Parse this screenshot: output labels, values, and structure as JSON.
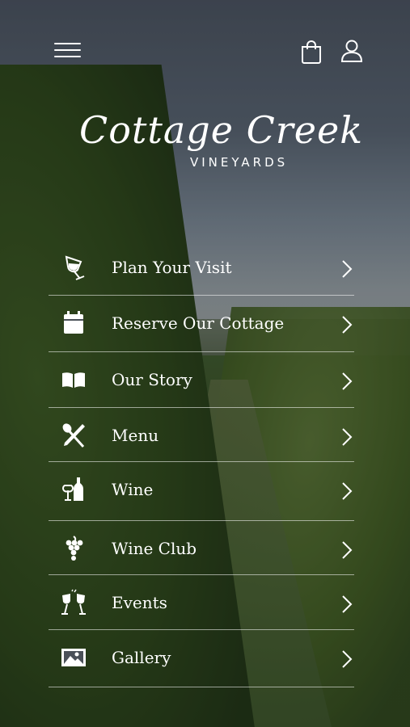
{
  "brand": {
    "script_name": "Cottage Creek",
    "subtitle": "VINEYARDS"
  },
  "header": {
    "menu_icon": "hamburger-menu-icon",
    "cart_icon": "shopping-bag-icon",
    "account_icon": "user-icon"
  },
  "menu": {
    "items": [
      {
        "label": "Plan Your Visit",
        "icon": "wine-glass-icon"
      },
      {
        "label": "Reserve Our Cottage",
        "icon": "calendar-icon"
      },
      {
        "label": "Our Story",
        "icon": "open-book-icon"
      },
      {
        "label": "Menu",
        "icon": "fork-knife-icon"
      },
      {
        "label": "Wine",
        "icon": "wine-bottle-icon"
      },
      {
        "label": "Wine Club",
        "icon": "grapes-icon"
      },
      {
        "label": "Events",
        "icon": "cheers-icon"
      },
      {
        "label": "Gallery",
        "icon": "image-icon"
      }
    ]
  },
  "colors": {
    "text": "#ffffff",
    "divider": "#ffffff",
    "overlay": "#14181c"
  }
}
